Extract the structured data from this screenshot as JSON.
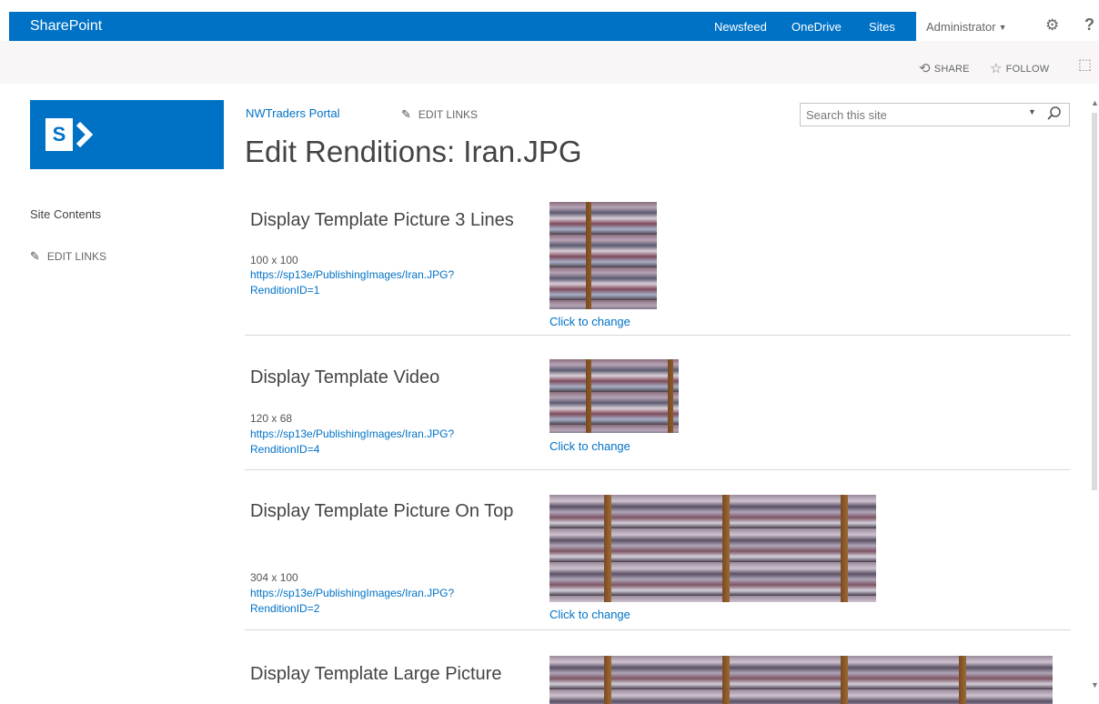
{
  "suite_bar": {
    "brand": "SharePoint",
    "links": [
      {
        "label": "Newsfeed"
      },
      {
        "label": "OneDrive"
      },
      {
        "label": "Sites"
      }
    ],
    "user": "Administrator",
    "settings_icon": "gear-icon",
    "help_label": "?"
  },
  "actions": {
    "share_label": "SHARE",
    "follow_label": "FOLLOW"
  },
  "left_nav": {
    "items": [
      {
        "label": "Site Contents"
      },
      {
        "label": "EDIT LINKS"
      }
    ]
  },
  "header": {
    "breadcrumb": "NWTraders Portal",
    "edit_links": "EDIT LINKS",
    "title": "Edit Renditions: Iran.JPG"
  },
  "search": {
    "placeholder": "Search this site"
  },
  "renditions": [
    {
      "title": "Display Template Picture 3 Lines",
      "size": "100 x 100",
      "url_line1": "https://sp13e/PublishingImages/Iran.JPG?",
      "url_line2": "RenditionID=1",
      "change_label": "Click to change"
    },
    {
      "title": "Display Template Video",
      "size": "120 x 68",
      "url_line1": "https://sp13e/PublishingImages/Iran.JPG?",
      "url_line2": "RenditionID=4",
      "change_label": "Click to change"
    },
    {
      "title": "Display Template Picture On Top",
      "size": "304 x 100",
      "url_line1": "https://sp13e/PublishingImages/Iran.JPG?",
      "url_line2": "RenditionID=2",
      "change_label": "Click to change"
    },
    {
      "title": "Display Template Large Picture"
    }
  ],
  "colors": {
    "brand_blue": "#0072c6",
    "text": "#444444",
    "link": "#0072c6"
  }
}
